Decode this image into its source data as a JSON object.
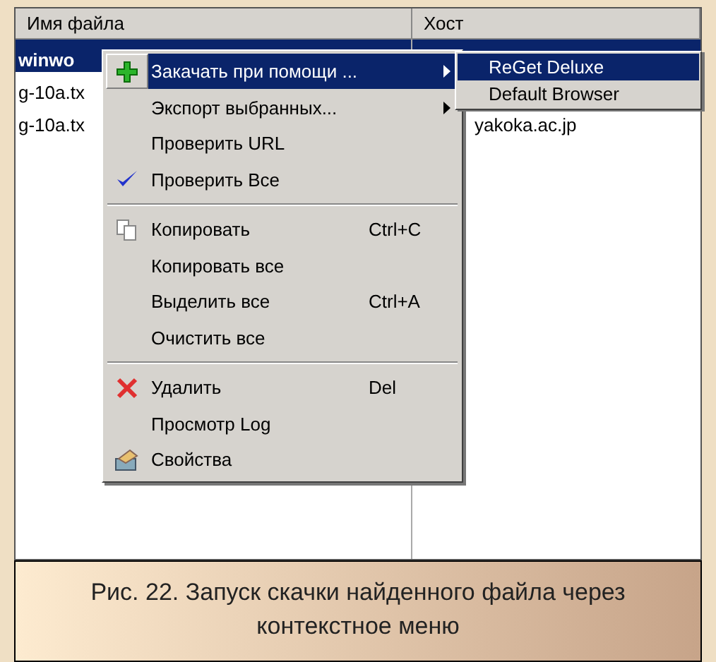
{
  "table": {
    "columns": [
      "Имя файла",
      "Хост"
    ],
    "rows": [
      {
        "cells": [
          "winwo",
          ""
        ],
        "selected": true
      },
      {
        "cells": [
          "g-10a.tx",
          ""
        ],
        "selected": false
      },
      {
        "cells": [
          "g-10a.tx",
          "yakoka.ac.jp"
        ],
        "selected": false
      }
    ]
  },
  "context_menu": {
    "items": [
      {
        "kind": "item",
        "label": "Закачать при помощи ...",
        "submenu": true,
        "selected": true
      },
      {
        "kind": "item",
        "label": "Экспорт выбранных...",
        "submenu": true,
        "selected": false
      },
      {
        "kind": "item",
        "label": "Проверить URL",
        "selected": false
      },
      {
        "kind": "item",
        "label": "Проверить Все",
        "selected": false
      },
      {
        "kind": "separator"
      },
      {
        "kind": "item",
        "label": "Копировать",
        "shortcut": "Ctrl+C",
        "selected": false
      },
      {
        "kind": "item",
        "label": "Копировать все",
        "selected": false
      },
      {
        "kind": "item",
        "label": "Выделить все",
        "shortcut": "Ctrl+A",
        "selected": false
      },
      {
        "kind": "item",
        "label": "Очистить все",
        "selected": false
      },
      {
        "kind": "separator"
      },
      {
        "kind": "item",
        "label": "Удалить",
        "shortcut": "Del",
        "selected": false
      },
      {
        "kind": "item",
        "label": "Просмотр Log",
        "selected": false
      },
      {
        "kind": "item",
        "label": "Свойства",
        "selected": false
      }
    ]
  },
  "submenu": {
    "items": [
      {
        "label": "ReGet Deluxe",
        "selected": true
      },
      {
        "label": "Default Browser",
        "selected": false
      }
    ]
  },
  "caption": "Рис. 22. Запуск скачки найденного файла через контекстное меню"
}
